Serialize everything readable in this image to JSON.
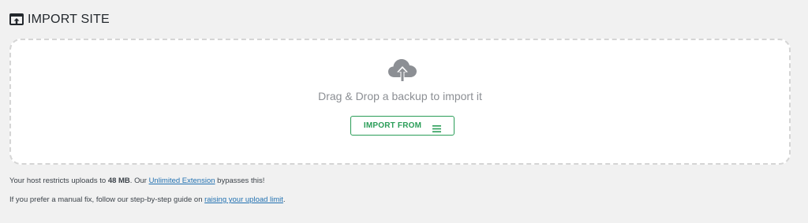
{
  "header": {
    "title": "IMPORT SITE",
    "icon": "import-site-icon"
  },
  "dropzone": {
    "icon": "cloud-upload-icon",
    "text": "Drag & Drop a backup to import it",
    "button_label": "IMPORT FROM",
    "button_icon": "menu-icon"
  },
  "notes": {
    "line1_prefix": "Your host restricts uploads to ",
    "line1_limit": "48 MB",
    "line1_mid": ". Our ",
    "line1_link": "Unlimited Extension",
    "line1_suffix": " bypasses this!",
    "line2_prefix": "If you prefer a manual fix, follow our step-by-step guide on ",
    "line2_link": "raising your upload limit",
    "line2_suffix": "."
  },
  "colors": {
    "accent": "#2a9d58",
    "link": "#2271b1",
    "border": "#d5d5d5",
    "cloud": "#8c8f94"
  }
}
